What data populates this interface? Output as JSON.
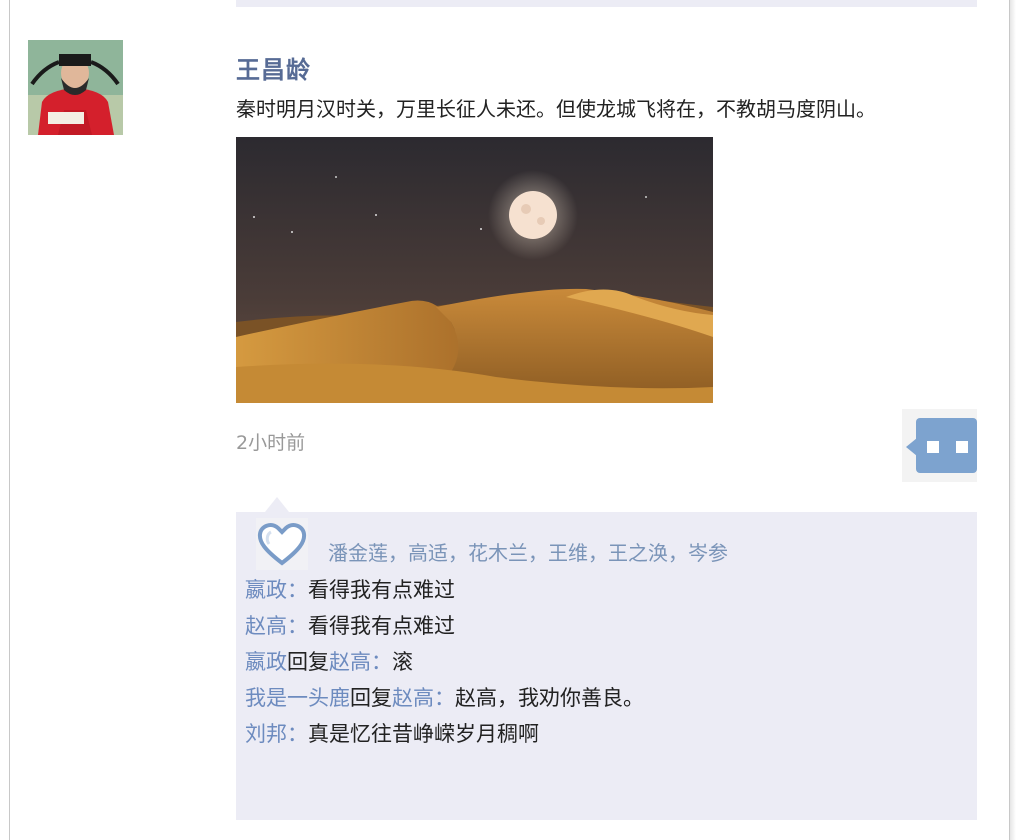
{
  "post": {
    "author": "王昌龄",
    "text": "秦时明月汉时关，万里长征人未还。但使龙城飞将在，不教胡马度阴山。",
    "timestamp": "2小时前"
  },
  "likes": {
    "names": "潘金莲，高适，花木兰，王维，王之涣，岑参"
  },
  "comments": [
    {
      "user": "嬴政",
      "separator": "：",
      "text": "看得我有点难过"
    },
    {
      "user": "赵高",
      "separator": "：",
      "text": "看得我有点难过"
    },
    {
      "user": "嬴政",
      "reply_word": "回复",
      "reply_to": "赵高",
      "separator": "：",
      "text": "滚"
    },
    {
      "user": "我是一头鹿",
      "reply_word": "回复",
      "reply_to": "赵高",
      "separator": "：",
      "text": "赵高，我劝你善良。"
    },
    {
      "user": "刘邦",
      "separator": "：",
      "text": "真是忆往昔峥嵘岁月稠啊"
    }
  ]
}
